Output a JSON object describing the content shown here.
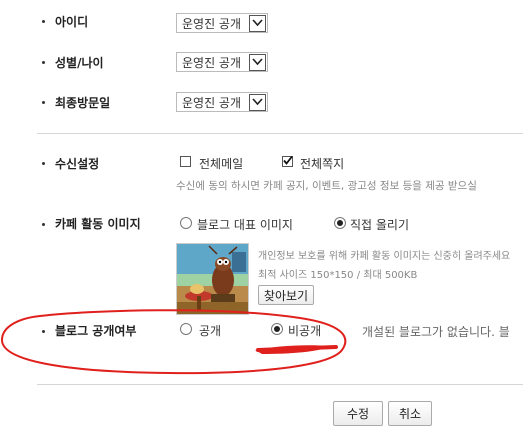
{
  "rows": {
    "id": {
      "label": "아이디",
      "value": "운영진 공개"
    },
    "gender_age": {
      "label": "성별/나이",
      "value": "운영진 공개"
    },
    "last_visit": {
      "label": "최종방문일",
      "value": "운영진 공개"
    }
  },
  "notify": {
    "label": "수신설정",
    "mail_label": "전체메일",
    "mail_checked": false,
    "note_label": "전체쪽지",
    "note_checked": true,
    "description": "수신에 동의 하시면 카페 공지, 이벤트, 광고성 정보 등을 제공 받으실"
  },
  "image": {
    "label": "카페 활동 이미지",
    "option_blog": "블로그 대표 이미지",
    "option_upload": "직접 올리기",
    "selected": "upload",
    "privacy_note": "개인정보 보호를 위해 카페 활동 이미지는 신중히 올려주세요",
    "size_note": "최적 사이즈 150*150 / 최대 500KB",
    "browse_label": "찾아보기",
    "thumbnail_icon": "cartoon-character-thumbnail"
  },
  "blog": {
    "label": "블로그 공개여부",
    "option_public": "공개",
    "option_private": "비공개",
    "selected": "private",
    "status_text": "개설된 블로그가 없습니다. 블"
  },
  "actions": {
    "edit_label": "수정",
    "cancel_label": "취소"
  },
  "annotation": {
    "color": "#e0201c"
  }
}
